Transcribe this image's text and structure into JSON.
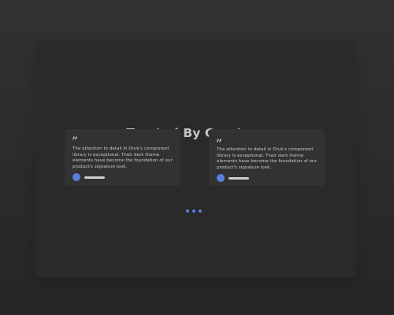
{
  "section": {
    "title": "Trusted By Creators"
  },
  "testimonials": [
    {
      "quote_icon": "quote-icon",
      "text": "The attention to detail in Druk's component library is exceptional. Their dark theme elements have become the foundation of our product's signature look."
    },
    {
      "quote_icon": "quote-icon",
      "text": "The attention to detail in Druk's component library is exceptional. Their dark theme elements have become the foundation of our product's signature look."
    }
  ],
  "colors": {
    "accent": "#5b7fe0",
    "card": "#323232",
    "panel": "#2a2a2a",
    "title": "#c6c6c6"
  },
  "carousel": {
    "dot_count": 3
  }
}
